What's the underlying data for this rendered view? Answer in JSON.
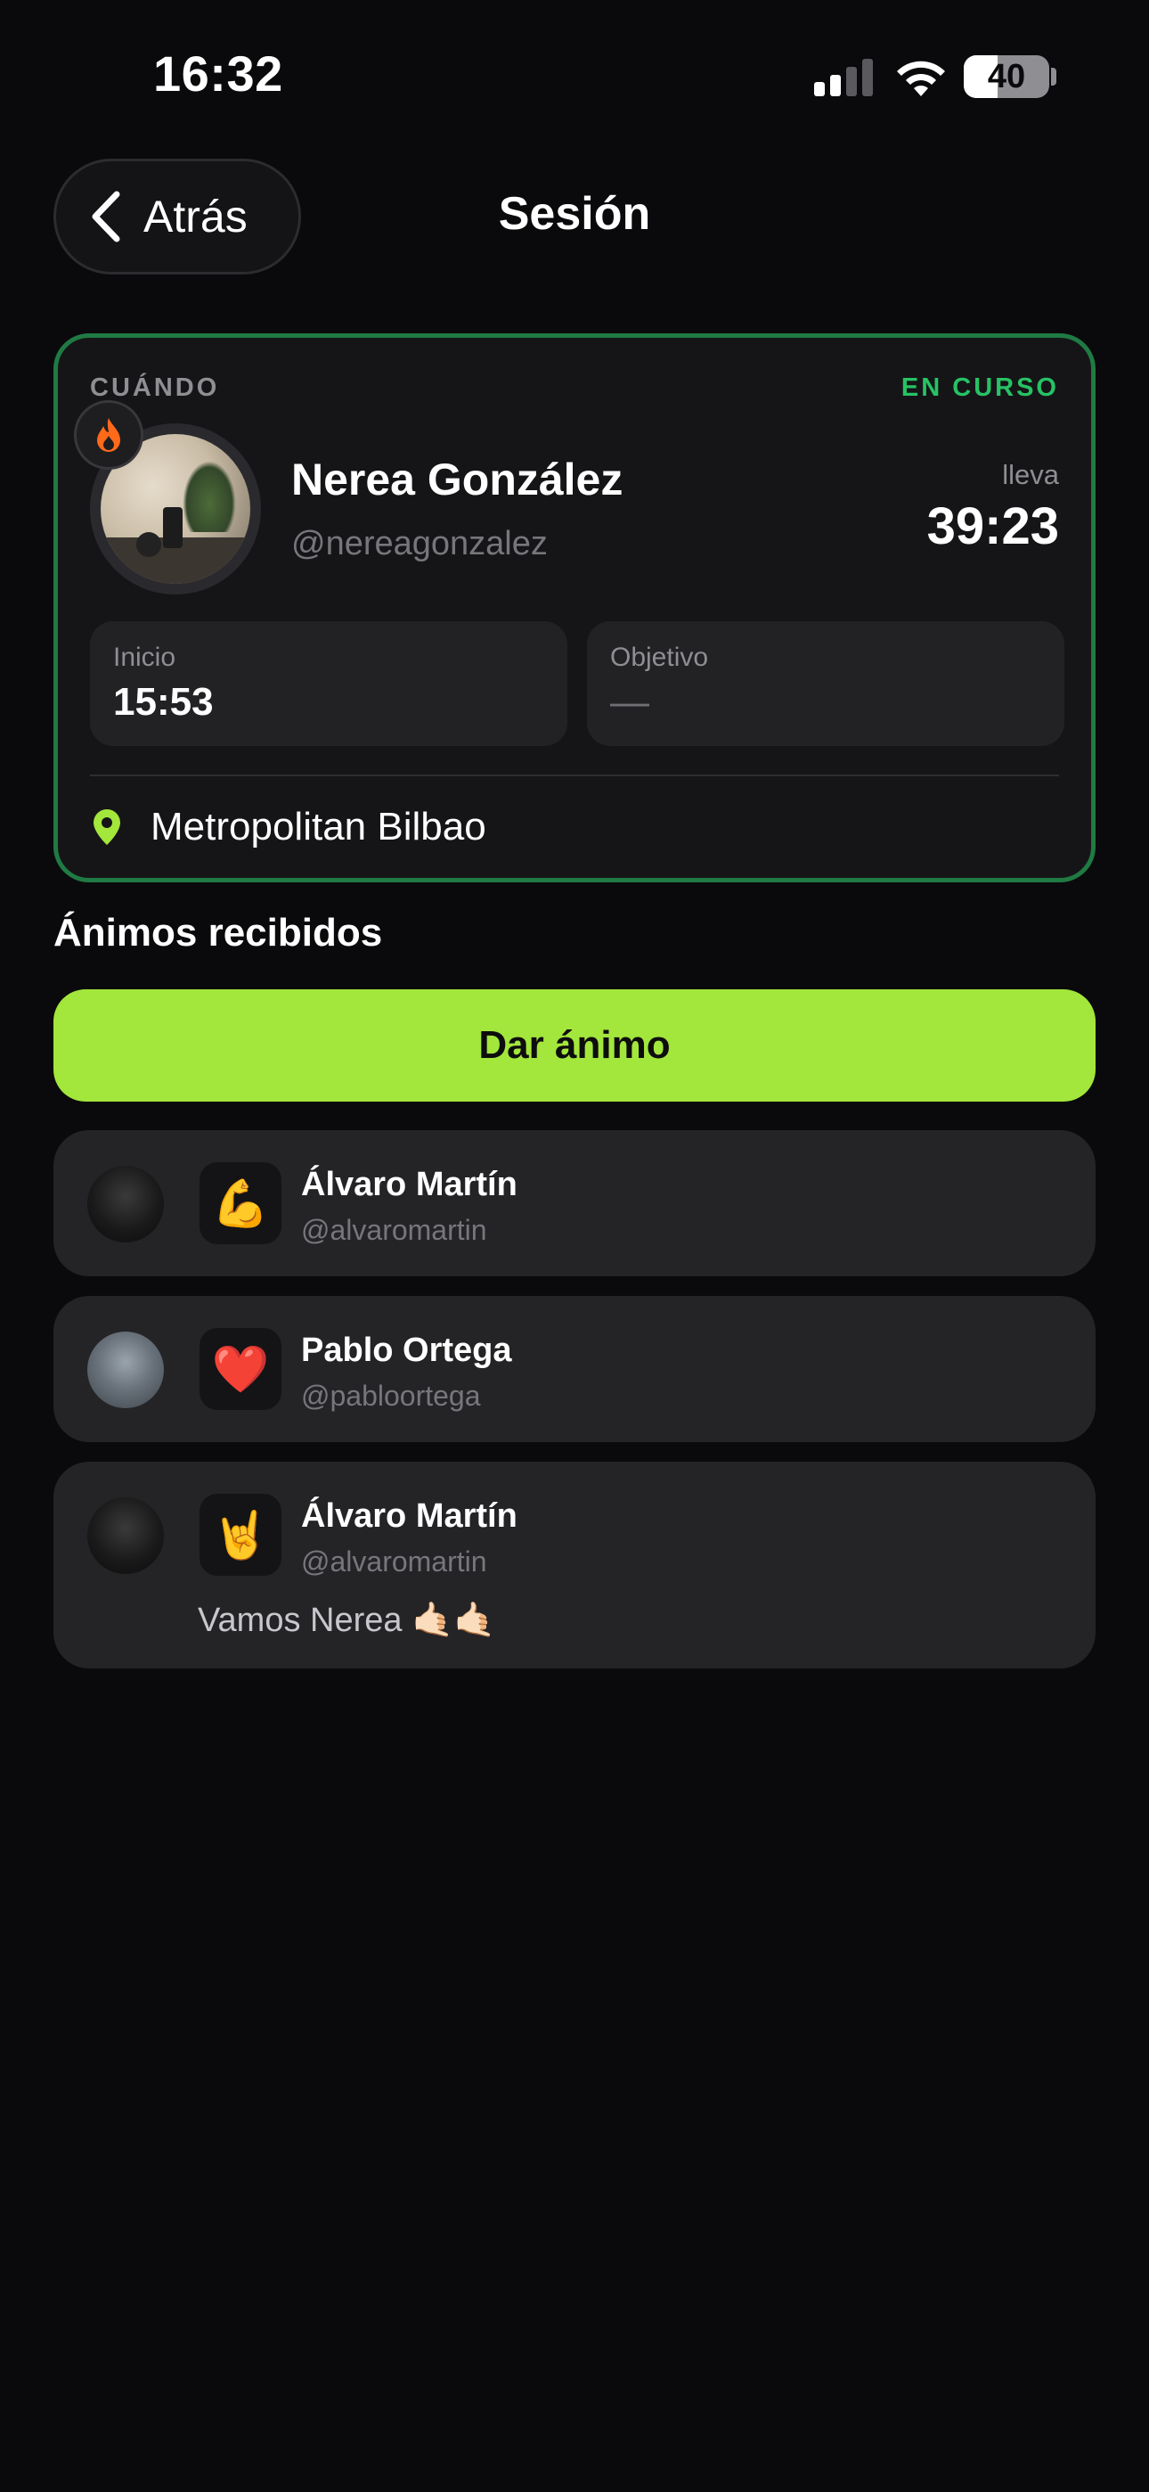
{
  "status_bar": {
    "time": "16:32",
    "battery": "40",
    "battery_level": 0.4
  },
  "header": {
    "back_label": "Atrás",
    "title": "Sesión"
  },
  "session": {
    "when_label": "CUÁNDO",
    "status": "EN CURSO",
    "user_name": "Nerea González",
    "user_handle": "@nereagonzalez",
    "elapsed_label": "lleva",
    "elapsed_value": "39:23",
    "start_label": "Inicio",
    "start_value": "15:53",
    "goal_label": "Objetivo",
    "goal_value": "—",
    "location": "Metropolitan Bilbao"
  },
  "cheers_section": {
    "title": "Ánimos recibidos",
    "button_label": "Dar ánimo",
    "items": [
      {
        "name": "Álvaro Martín",
        "handle": "@alvaromartin",
        "emoji": "💪",
        "message": ""
      },
      {
        "name": "Pablo Ortega",
        "handle": "@pabloortega",
        "emoji": "❤️",
        "message": ""
      },
      {
        "name": "Álvaro Martín",
        "handle": "@alvaromartin",
        "emoji": "🤘",
        "message": "Vamos Nerea 🤙🏻🤙🏻"
      }
    ]
  },
  "colors": {
    "accent": "#a3e63c",
    "status_green": "#27c265",
    "card_border": "#1f7a43",
    "fire": "#ff6a1a"
  },
  "icons": [
    "signal-icon",
    "wifi-icon",
    "battery-icon",
    "chevron-left-icon",
    "fire-icon",
    "location-pin-icon"
  ]
}
